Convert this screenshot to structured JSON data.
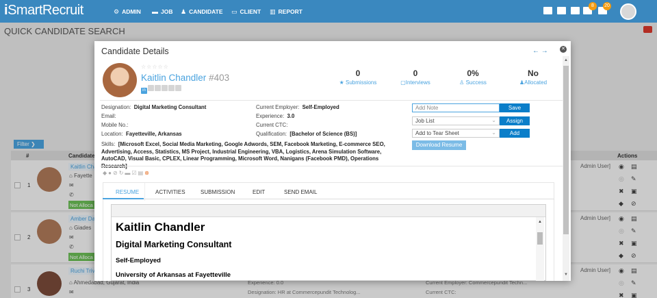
{
  "header": {
    "logo_i": "i",
    "logo_rest": "SmartRecruit",
    "nav": [
      {
        "label": "ADMIN",
        "icon": "gear-icon"
      },
      {
        "label": "JOB",
        "icon": "briefcase-icon"
      },
      {
        "label": "CANDIDATE",
        "icon": "user-icon"
      },
      {
        "label": "CLIENT",
        "icon": "id-card-icon"
      },
      {
        "label": "REPORT",
        "icon": "bar-chart-icon"
      }
    ],
    "badges": [
      "8",
      "20"
    ]
  },
  "page": {
    "title": "QUICK CANDIDATE SEARCH",
    "filter_label": "Filter",
    "col_num": "#",
    "col_candidate": "Candidate",
    "col_actions": "Actions",
    "rows": [
      {
        "num": "1",
        "name": "Kaitlin Cha",
        "loc": "Fayette",
        "status": "Not Alloca",
        "owner": "Admin User]"
      },
      {
        "num": "2",
        "name": "Amber Da",
        "loc": "Giades",
        "status": "Not Alloca",
        "owner": "Admin User]"
      },
      {
        "num": "3",
        "name": "Ruchi Triv",
        "loc": "Ahmedabad, Gujarat, India",
        "owner": "Admin User]",
        "experience": "Experience: 0.0",
        "designation": "Designation: HR at Commercepundit Technolog...",
        "employer": "Current Employer: Commercepundit Techn...",
        "ctc": "Current CTC:"
      }
    ]
  },
  "modal": {
    "title": "Candidate Details",
    "candidate_name": "Kaitlin Chandler",
    "candidate_id": "#403",
    "stats": [
      {
        "value": "0",
        "label": "Submissions",
        "icon": "star-icon"
      },
      {
        "value": "0",
        "label": "Interviews",
        "icon": "calendar-icon"
      },
      {
        "value": "0%",
        "label": "Success",
        "icon": "thumbs-up-icon"
      },
      {
        "value": "No",
        "label": "Allocated",
        "icon": "user-icon"
      }
    ],
    "info_left": [
      {
        "label": "Designation:",
        "value": "Digital Marketing Consultant"
      },
      {
        "label": "Email:",
        "value": ""
      },
      {
        "label": "Mobile No.:",
        "value": ""
      },
      {
        "label": "Location:",
        "value": "Fayetteville, Arkansas"
      }
    ],
    "info_right": [
      {
        "label": "Current Employer:",
        "value": "Self-Employed"
      },
      {
        "label": "Experience:",
        "value": "3.0"
      },
      {
        "label": "Current CTC:",
        "value": ""
      },
      {
        "label": "Qualification:",
        "value": "[Bachelor of Science (BS)]"
      }
    ],
    "skills_label": "Skills:",
    "skills_value": "[Microsoft Excel, Social Media Marketing, Google Adwords, SEM, Facebook Marketing, E-commerce SEO, Advertising, Access, Statistics, MS Project, Industrial Engineering, VBA, Logistics, Arena Simulation Software, AutoCAD, Visual Basic, CPLEX, Linear Programming, Microsoft Word, Nanigans (Facebook PMD), Operations Research]",
    "note_placeholder": "Add Note",
    "save_label": "Save",
    "job_list": "Job List",
    "assign_label": "Assign",
    "tear_sheet": "Add to Tear Sheet",
    "add_label": "Add",
    "download_label": "Download Resume",
    "tabs": [
      "RESUME",
      "ACTIVITIES",
      "SUBMISSION",
      "EDIT",
      "SEND EMAIL"
    ],
    "resume": {
      "name": "Kaitlin Chandler",
      "title": "Digital Marketing Consultant",
      "employer": "Self-Employed",
      "school": "University of Arkansas at Fayetteville"
    }
  },
  "colors": {
    "header_bg": "#3a88bf",
    "accent": "#4aa3df",
    "button": "#0b7ec9",
    "status_green": "#6cbf57"
  }
}
